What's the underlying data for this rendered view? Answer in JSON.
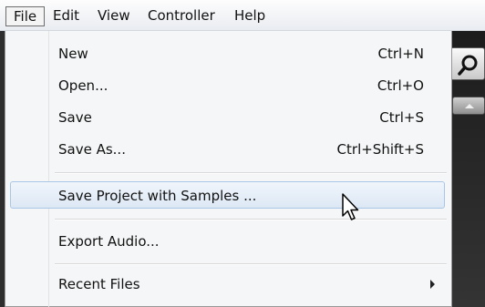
{
  "menubar": {
    "items": [
      {
        "label": "File"
      },
      {
        "label": "Edit"
      },
      {
        "label": "View"
      },
      {
        "label": "Controller"
      },
      {
        "label": "Help"
      }
    ]
  },
  "file_menu": {
    "items": [
      {
        "label": "New",
        "shortcut": "Ctrl+N"
      },
      {
        "label": "Open...",
        "shortcut": "Ctrl+O"
      },
      {
        "label": "Save",
        "shortcut": "Ctrl+S"
      },
      {
        "label": "Save As...",
        "shortcut": "Ctrl+Shift+S"
      },
      {
        "label": "Save Project with Samples ...",
        "highlighted": true
      },
      {
        "label": "Export Audio..."
      },
      {
        "label": "Recent Files",
        "has_submenu": true
      }
    ]
  },
  "icons": {
    "search": "search-icon",
    "scroll_up": "scroll-up-arrow-icon",
    "submenu": "submenu-arrow-icon",
    "cursor": "mouse-cursor-icon"
  },
  "colors": {
    "menu_background": "#f5f6f7",
    "highlight_border": "#a9c6e6",
    "app_background": "#2e2e2e"
  }
}
